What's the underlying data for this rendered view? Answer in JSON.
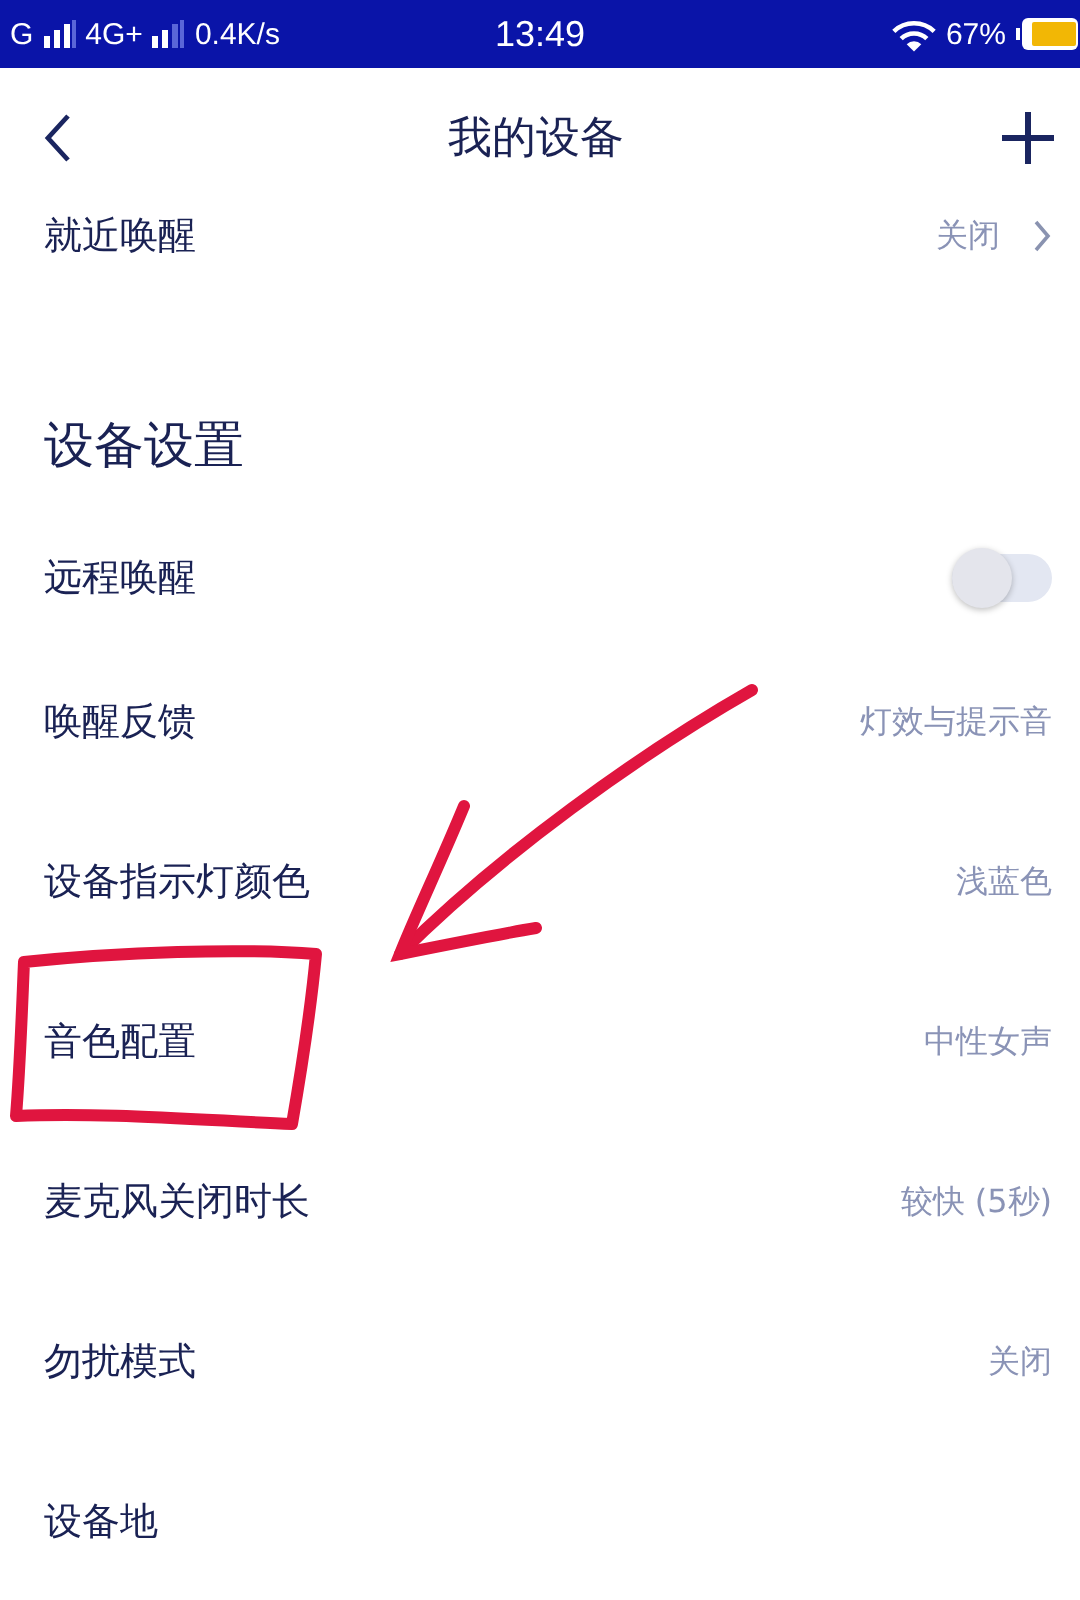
{
  "status_bar": {
    "network_1": "G",
    "network_2": "4G+",
    "speed": "0.4K/s",
    "time": "13:49",
    "battery": "67%"
  },
  "nav": {
    "title": "我的设备"
  },
  "top_rows": [
    {
      "label": "就近唤醒",
      "value": "关闭",
      "kind": "link"
    }
  ],
  "section": {
    "title": "设备设置"
  },
  "rows": [
    {
      "label": "远程唤醒",
      "kind": "toggle",
      "on": false
    },
    {
      "label": "唤醒反馈",
      "kind": "value",
      "value": "灯效与提示音"
    },
    {
      "label": "设备指示灯颜色",
      "kind": "value",
      "value": "浅蓝色"
    },
    {
      "label": "音色配置",
      "kind": "value",
      "value": "中性女声"
    },
    {
      "label": "麦克风关闭时长",
      "kind": "value",
      "value": "较快 (5秒)"
    },
    {
      "label": "勿扰模式",
      "kind": "value",
      "value": "关闭"
    },
    {
      "label": "设备地",
      "kind": "label"
    }
  ]
}
